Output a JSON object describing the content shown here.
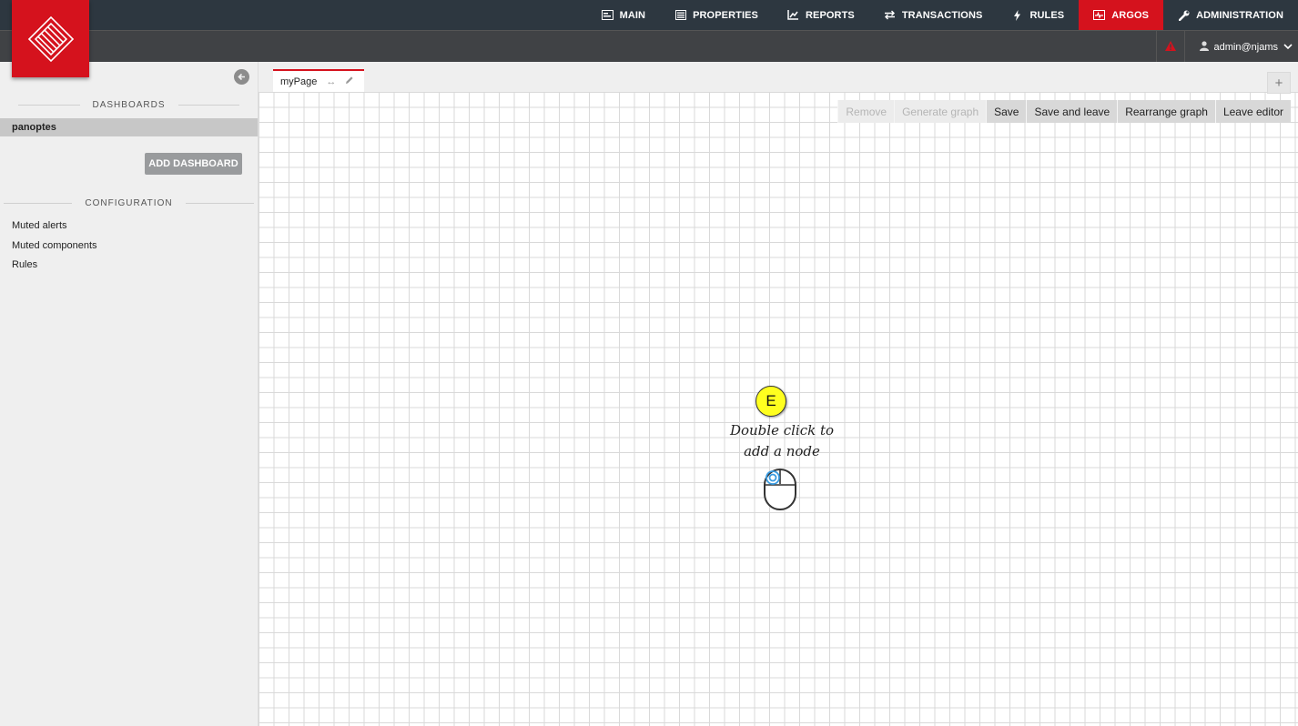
{
  "nav": {
    "items": [
      {
        "label": "MAIN",
        "icon": "main-icon"
      },
      {
        "label": "PROPERTIES",
        "icon": "properties-icon"
      },
      {
        "label": "REPORTS",
        "icon": "reports-chart-icon"
      },
      {
        "label": "TRANSACTIONS",
        "icon": "transactions-arrows-icon"
      },
      {
        "label": "RULES",
        "icon": "lightning-icon"
      },
      {
        "label": "ARGOS",
        "icon": "argos-monitor-icon"
      },
      {
        "label": "ADMINISTRATION",
        "icon": "wrench-icon"
      }
    ],
    "active": "ARGOS",
    "accent": "#d5121d",
    "bar_color": "#2d3740"
  },
  "user": {
    "name": "admin@njams",
    "icon": "user-icon",
    "menu_icon": "chevron-down-icon"
  },
  "alert_icon": "warning-triangle-icon",
  "sidebar": {
    "dashboards_heading": "DASHBOARDS",
    "dashboards": [
      {
        "label": "panoptes"
      }
    ],
    "add_dashboard_label": "ADD DASHBOARD",
    "configuration_heading": "CONFIGURATION",
    "config_links": [
      {
        "label": "Muted alerts"
      },
      {
        "label": "Muted components"
      },
      {
        "label": "Rules"
      }
    ]
  },
  "editor": {
    "tab_label": "myPage",
    "add_tab_label": "+",
    "toolbar": {
      "remove": "Remove",
      "generate": "Generate graph",
      "save": "Save",
      "save_leave": "Save and leave",
      "rearrange": "Rearrange graph",
      "leave": "Leave editor"
    },
    "marker_label": "E",
    "hint": "Double click to\nadd a node"
  }
}
